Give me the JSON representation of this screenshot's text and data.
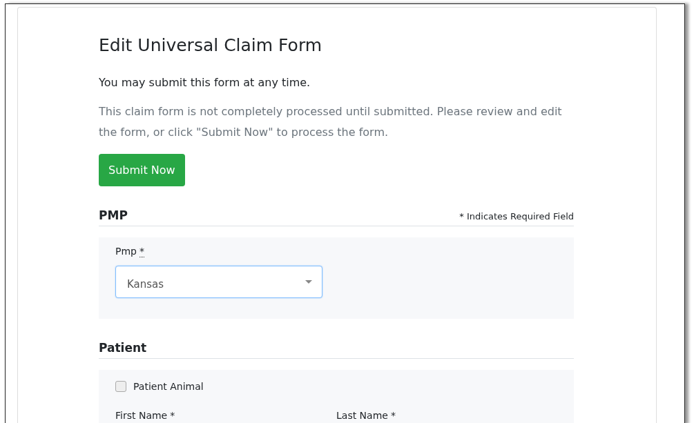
{
  "title": "Edit Universal Claim Form",
  "intro": "You may submit this form at any time.",
  "note": "This claim form is not completely processed until submitted. Please review and edit the form, or click \"Submit Now\" to process the form.",
  "submit_button": "Submit Now",
  "sections": [
    {
      "heading": "PMP",
      "required_note": "* Indicates Required Field",
      "fields": [
        {
          "kind": "select",
          "label": "Pmp",
          "required_mark": "*",
          "value": "Kansas",
          "focused": true
        }
      ]
    },
    {
      "heading": "Patient",
      "fields": [
        {
          "kind": "checkbox",
          "label": "Patient Animal",
          "checked": false
        },
        {
          "kind": "pair",
          "items": [
            {
              "label": "First Name",
              "required_mark": "*"
            },
            {
              "label": "Last Name",
              "required_mark": "*"
            }
          ]
        }
      ]
    }
  ]
}
